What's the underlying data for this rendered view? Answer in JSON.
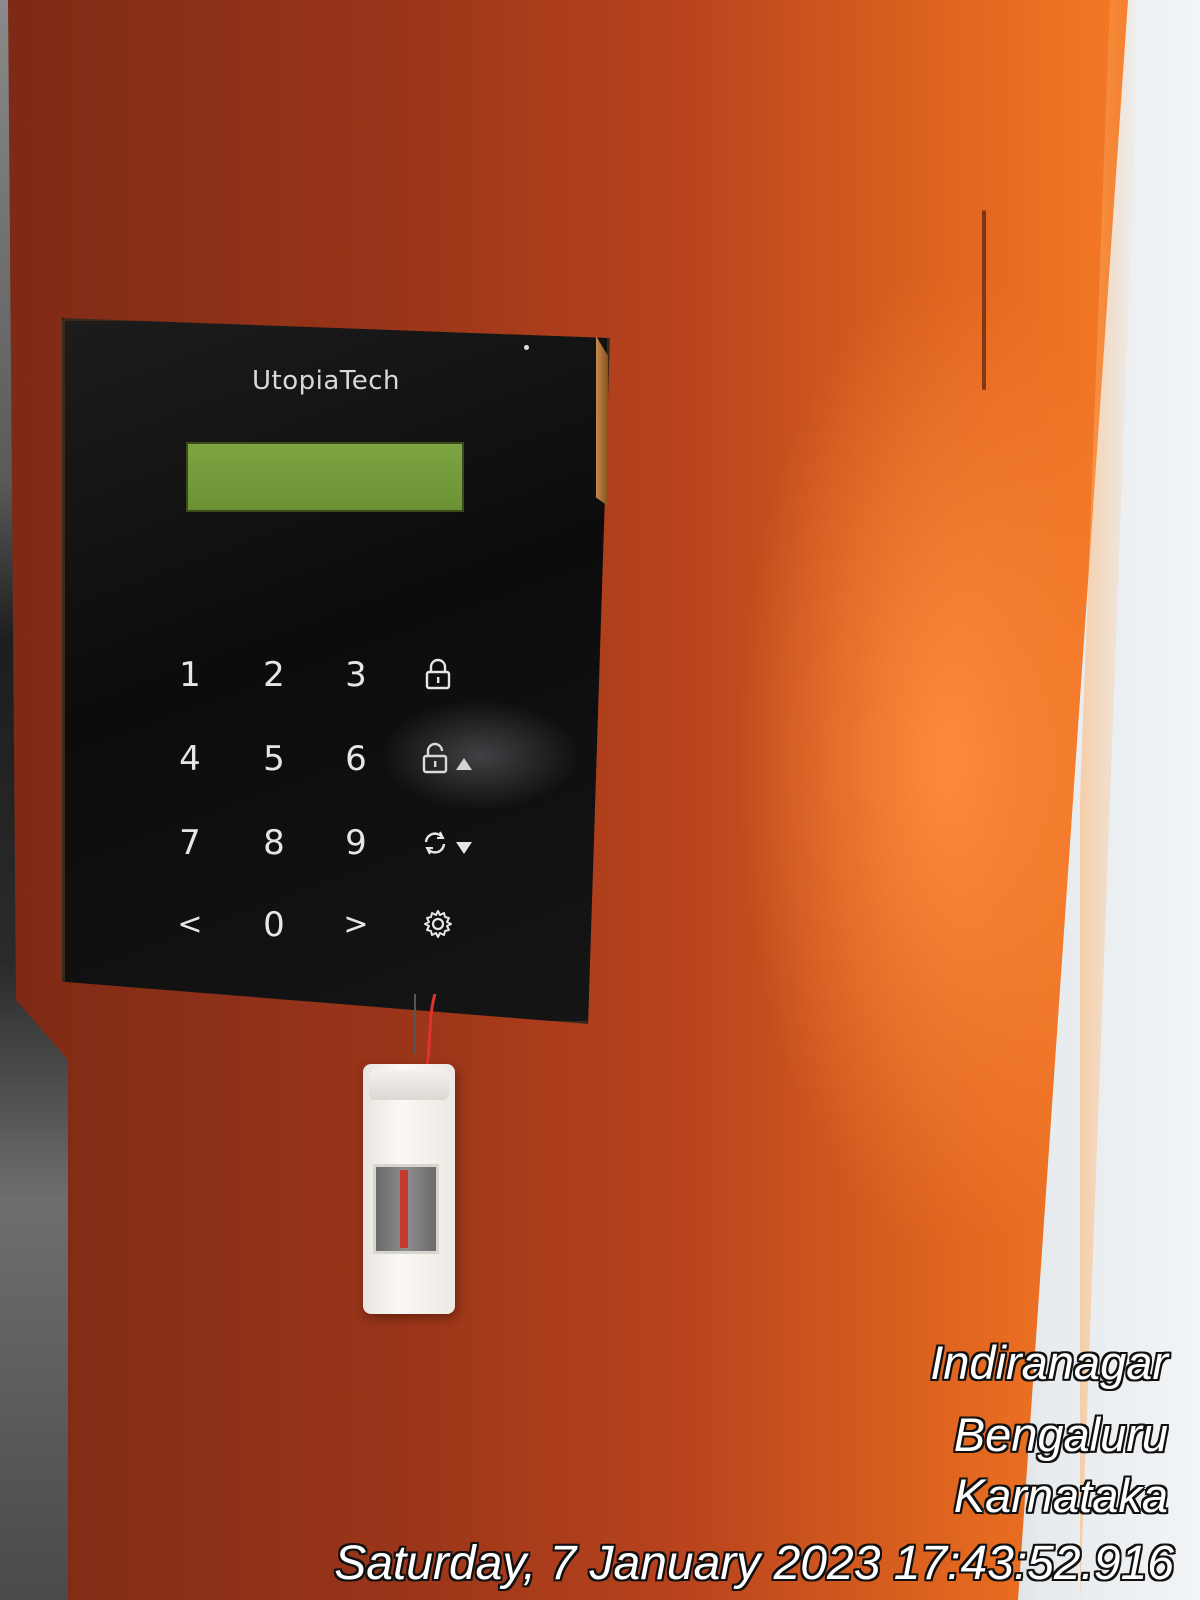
{
  "brand": "UtopiaTech",
  "keypad": {
    "rows": [
      [
        {
          "type": "text",
          "label": "1"
        },
        {
          "type": "text",
          "label": "2"
        },
        {
          "type": "text",
          "label": "3"
        },
        {
          "type": "icon",
          "icon": "lock-icon"
        }
      ],
      [
        {
          "type": "text",
          "label": "4"
        },
        {
          "type": "text",
          "label": "5"
        },
        {
          "type": "text",
          "label": "6"
        },
        {
          "type": "icon",
          "icon": "unlock-up-icon"
        }
      ],
      [
        {
          "type": "text",
          "label": "7"
        },
        {
          "type": "text",
          "label": "8"
        },
        {
          "type": "text",
          "label": "9"
        },
        {
          "type": "icon",
          "icon": "refresh-down-icon"
        }
      ],
      [
        {
          "type": "text",
          "label": "<"
        },
        {
          "type": "text",
          "label": "0"
        },
        {
          "type": "text",
          "label": ">"
        },
        {
          "type": "icon",
          "icon": "gear-icon"
        }
      ]
    ]
  },
  "overlay": {
    "locality": "Indiranagar",
    "city": "Bengaluru",
    "state": "Karnataka",
    "datetime": "Saturday, 7 January 2023 17:43:52.916"
  },
  "colors": {
    "door": "#b8431d",
    "door_glow": "#f47a26",
    "keypad": "#111111",
    "lcd": "#7ea443",
    "wire": "#e0332a",
    "button": "#f5f2ee"
  }
}
